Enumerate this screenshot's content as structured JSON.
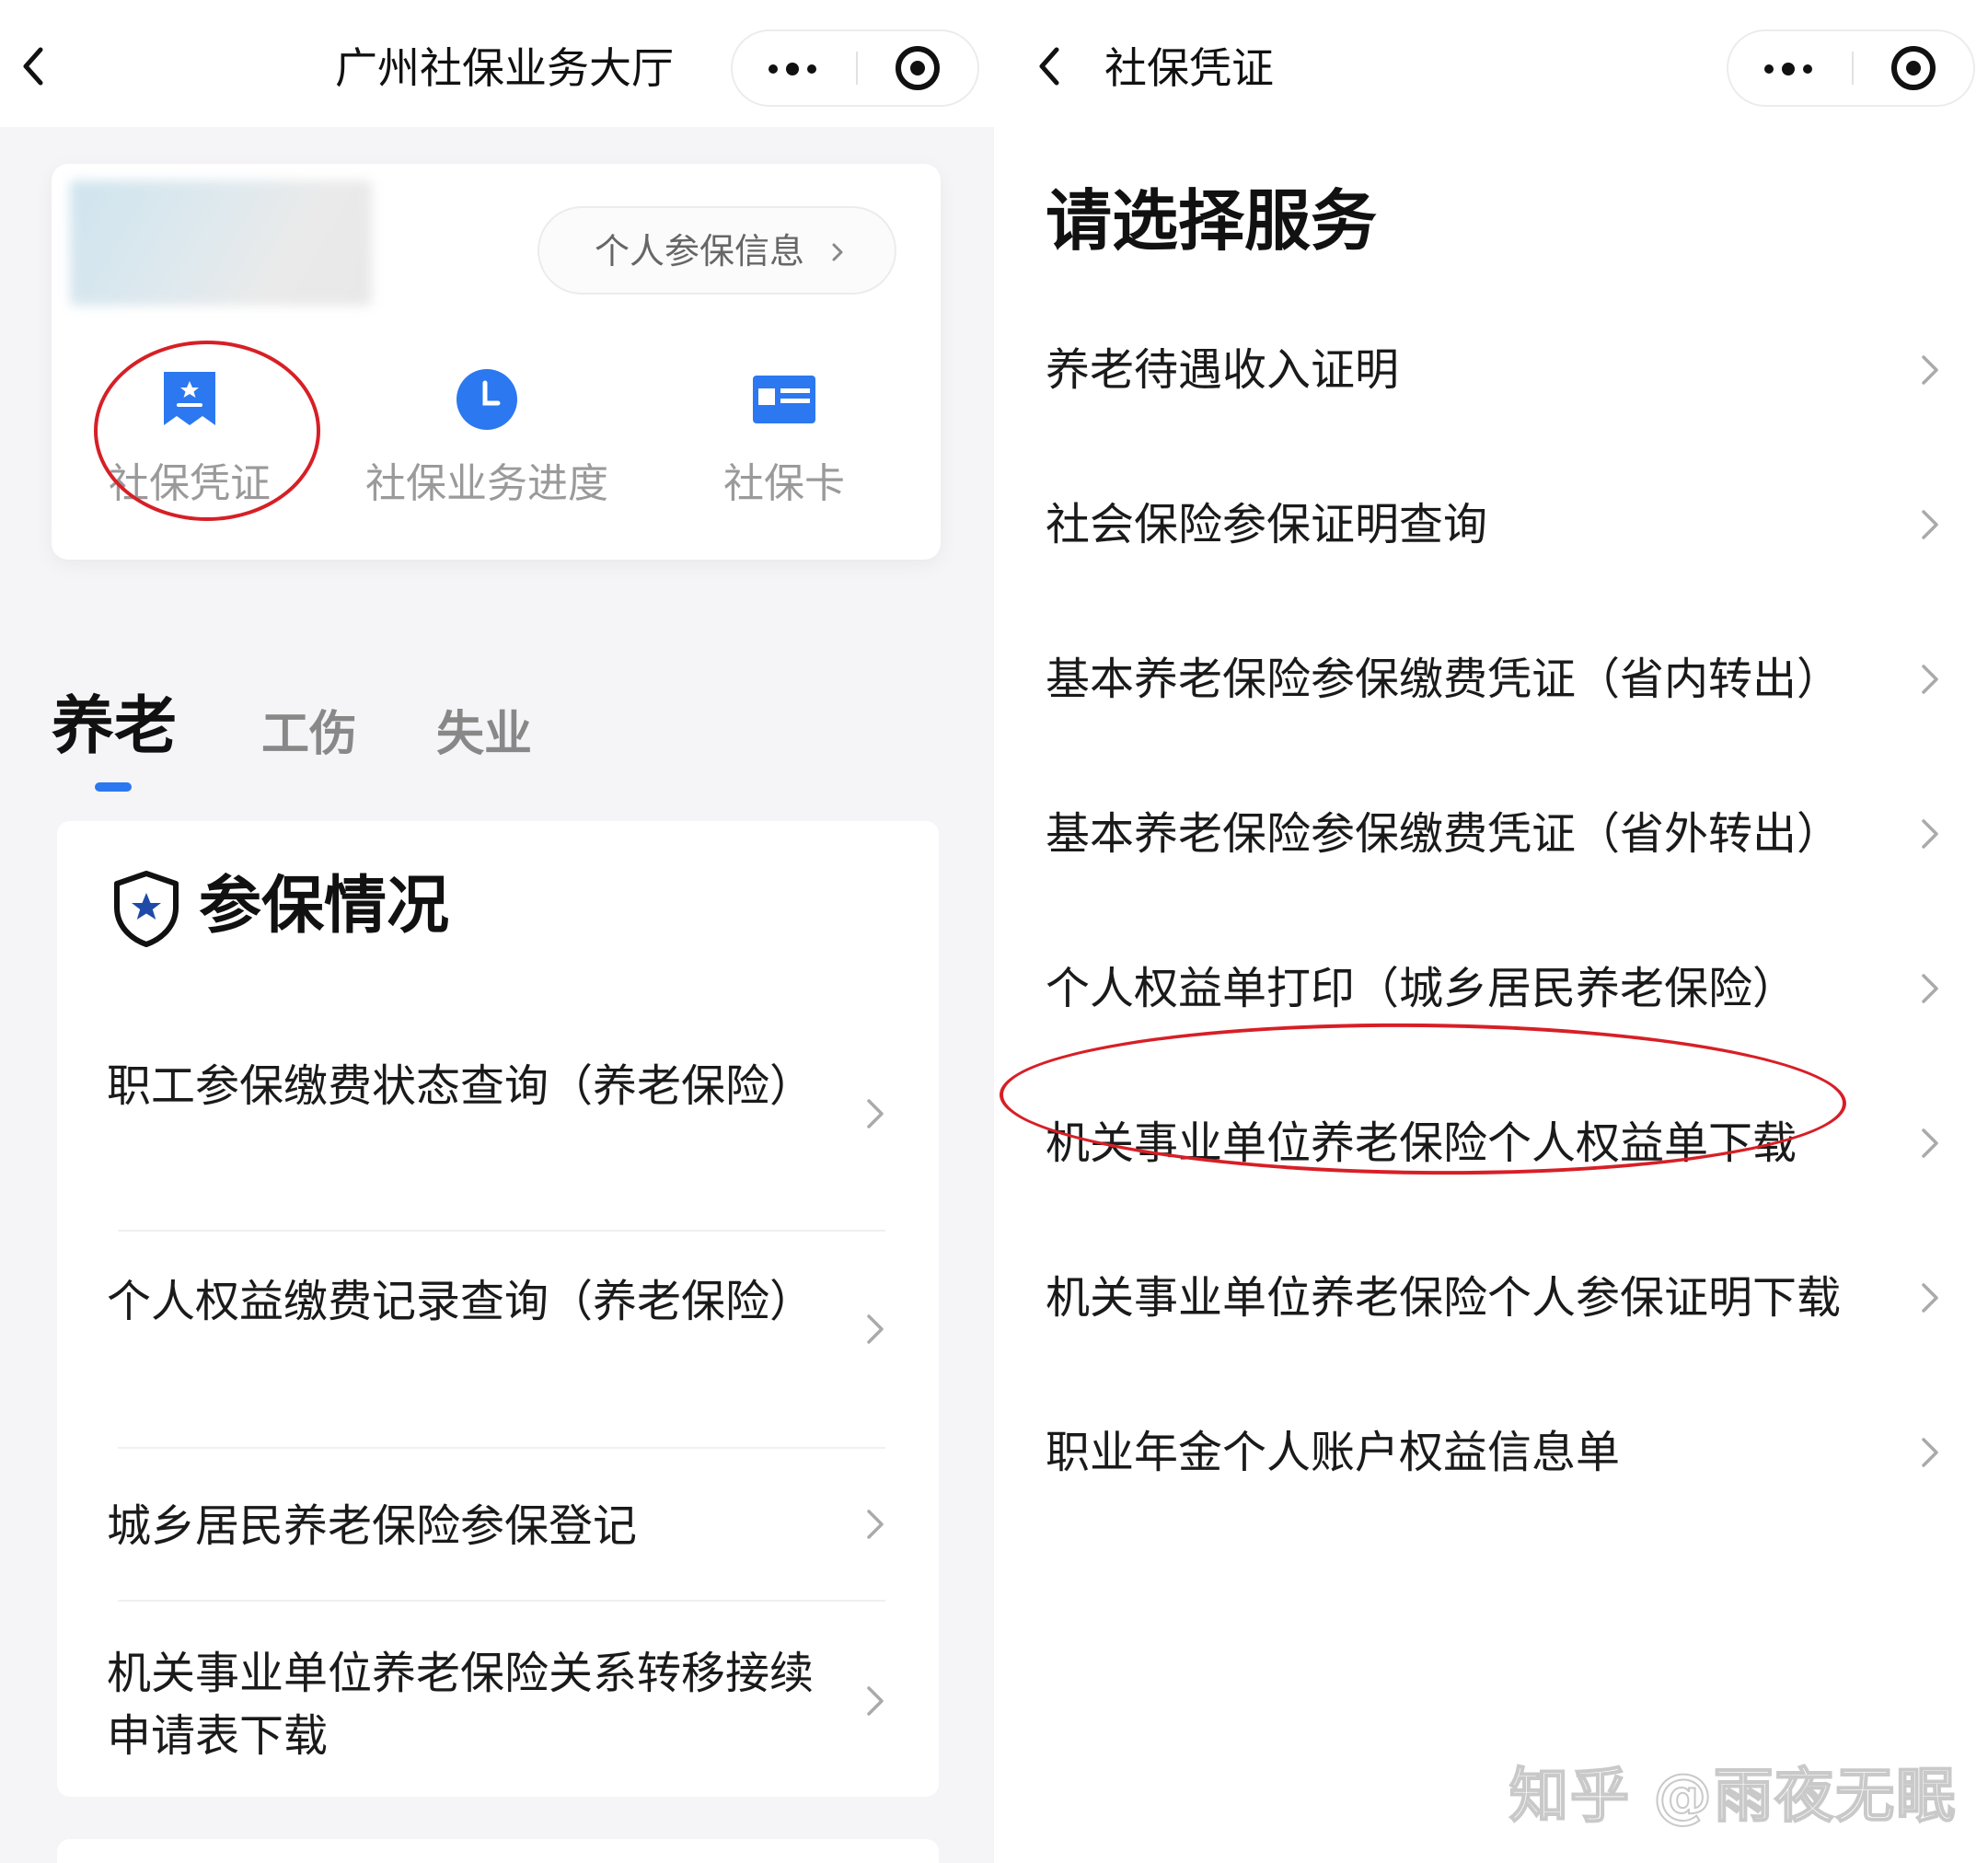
{
  "left": {
    "nav": {
      "title": "广州社保业务大厅"
    },
    "profile_button": {
      "label": "个人参保信息"
    },
    "quick_actions": [
      {
        "label": "社保凭证",
        "icon": "certificate-icon",
        "color": "#2b78f0"
      },
      {
        "label": "社保业务进度",
        "icon": "clock-icon",
        "color": "#2b78f0"
      },
      {
        "label": "社保卡",
        "icon": "card-icon",
        "color": "#2b78f0"
      }
    ],
    "tabs": [
      "养老",
      "工伤",
      "失业"
    ],
    "active_tab": "养老",
    "section": {
      "title": "参保情况",
      "icon": "shield-star-icon",
      "items": [
        "职工参保缴费状态查询（养老保险）",
        "个人权益缴费记录查询（养老保险）",
        "城乡居民养老保险参保登记",
        "机关事业单位养老保险关系转移接续申请表下载"
      ]
    },
    "highlighted_action": "社保凭证"
  },
  "right": {
    "nav": {
      "title": "社保凭证"
    },
    "heading": "请选择服务",
    "items": [
      "养老待遇收入证明",
      "社会保险参保证明查询",
      "基本养老保险参保缴费凭证（省内转出）",
      "基本养老保险参保缴费凭证（省外转出）",
      "个人权益单打印（城乡居民养老保险）",
      "机关事业单位养老保险个人权益单下载",
      "机关事业单位养老保险个人参保证明下载",
      "职业年金个人账户权益信息单"
    ],
    "highlighted_item": "机关事业单位养老保险个人权益单下载"
  },
  "watermark": "知乎 @雨夜无眠",
  "colors": {
    "accent": "#2b78f0",
    "annotation": "#d71f26",
    "tab_indicator": "#2b78f0"
  }
}
